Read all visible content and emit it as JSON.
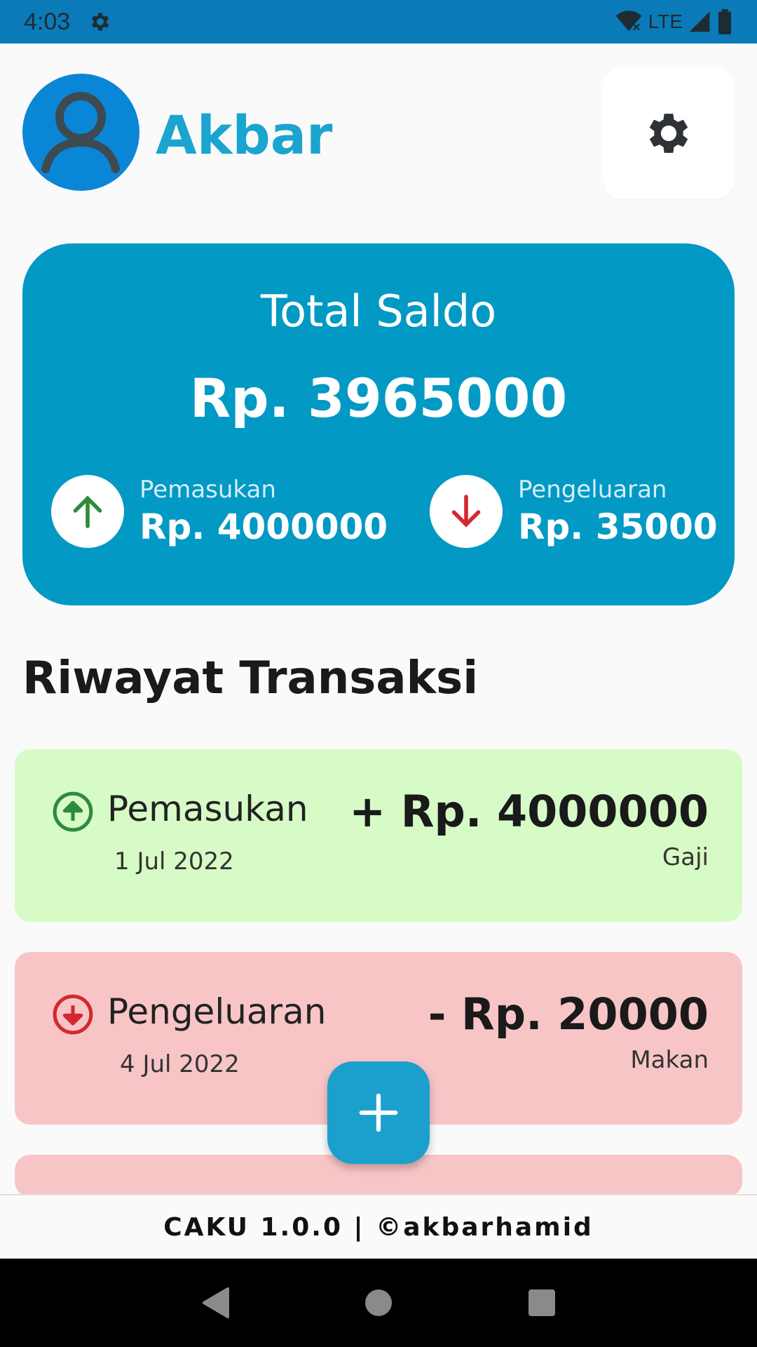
{
  "status_bar": {
    "time": "4:03",
    "network": "LTE",
    "icons": [
      "gear-icon",
      "wifi-icon",
      "signal-icon",
      "battery-icon"
    ]
  },
  "header": {
    "user_name": "Akbar",
    "avatar_icon": "user-icon",
    "settings_icon": "gear-icon"
  },
  "balance": {
    "title": "Total Saldo",
    "amount": "Rp. 3965000",
    "income": {
      "label": "Pemasukan",
      "value": "Rp. 4000000",
      "icon": "arrow-up-icon"
    },
    "expense": {
      "label": "Pengeluaran",
      "value": "Rp. 35000",
      "icon": "arrow-down-icon"
    }
  },
  "history": {
    "title": "Riwayat Transaksi",
    "transactions": [
      {
        "type": "Pemasukan",
        "date": "1 Jul 2022",
        "amount": "+ Rp. 4000000",
        "note": "Gaji",
        "icon": "arrow-up-circle-icon"
      },
      {
        "type": "Pengeluaran",
        "date": "4 Jul 2022",
        "amount": "- Rp. 20000",
        "note": "Makan",
        "icon": "arrow-down-circle-icon"
      }
    ]
  },
  "fab": {
    "icon": "plus-icon"
  },
  "footer": {
    "text": "CAKU 1.0.0 | ©akbarhamid"
  },
  "colors": {
    "status_bar": "#0a7bb8",
    "accent": "#0299c4",
    "name": "#1ba4cf",
    "income_card": "#d7fbc6",
    "expense_card": "#f8c5c7",
    "income_icon": "#2e8b3a",
    "expense_icon": "#d3292f"
  }
}
